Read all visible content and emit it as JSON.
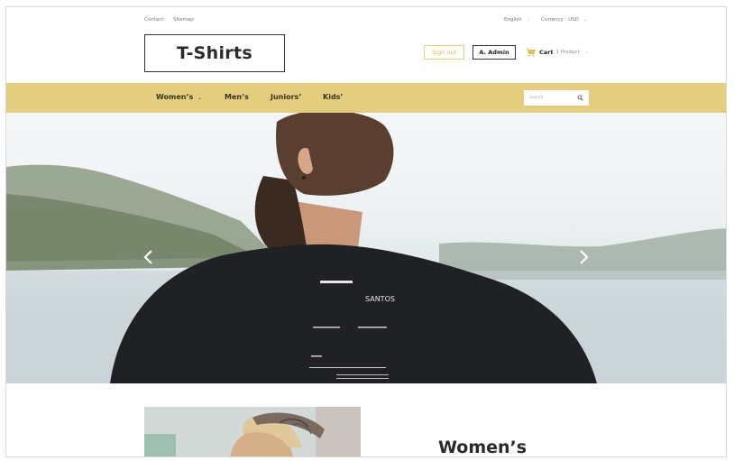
{
  "topbar": {
    "contact": "Contact",
    "sitemap": "Sitemap",
    "language": "English",
    "currency": "Currency : USD"
  },
  "header": {
    "logo": "T-Shirts",
    "sign_out": "Sign out",
    "user": "A. Admin",
    "cart_label": "Cart",
    "cart_count": "1 Product"
  },
  "nav": {
    "items": [
      {
        "label": "Women’s",
        "has_dropdown": true
      },
      {
        "label": "Men’s",
        "has_dropdown": false
      },
      {
        "label": "Juniors’",
        "has_dropdown": false
      },
      {
        "label": "Kids’",
        "has_dropdown": false
      }
    ],
    "search_placeholder": "Search"
  },
  "hero": {
    "shirt_print": "SANTOS"
  },
  "promo": {
    "title": "Women’s"
  },
  "colors": {
    "accent": "#e2ce7e",
    "accent_text": "#d9b640",
    "shirt": "#1f2125"
  }
}
